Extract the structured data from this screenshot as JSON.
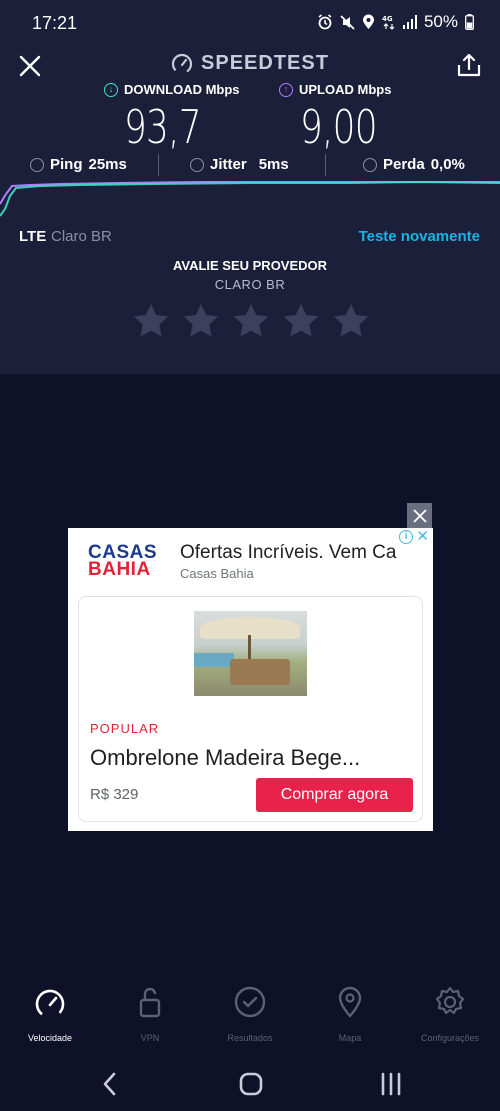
{
  "status_bar": {
    "time": "17:21",
    "battery_text": "50%",
    "icons": [
      "alarm-icon",
      "mute-icon",
      "location-icon",
      "4g-icon",
      "signal-icon",
      "battery-icon"
    ]
  },
  "header": {
    "brand": "SPEEDTEST"
  },
  "results": {
    "download_label": "DOWNLOAD Mbps",
    "upload_label": "UPLOAD Mbps",
    "download_value": "93,7",
    "upload_value": "9,00",
    "ping_label": "Ping",
    "ping_value": "25ms",
    "jitter_label": "Jitter",
    "jitter_value": "5ms",
    "loss_label": "Perda",
    "loss_value": "0,0%"
  },
  "network": {
    "type": "LTE",
    "provider": "Claro BR",
    "retest_label": "Teste novamente"
  },
  "rating": {
    "title": "AVALIE SEU PROVEDOR",
    "provider": "CLARO BR",
    "stars_total": 5,
    "stars_filled": 0
  },
  "ad": {
    "logo_line1": "CASAS",
    "logo_line2": "BAHIA",
    "headline": "Ofertas Incríveis. Vem Ca",
    "advertiser": "Casas Bahia",
    "tag": "POPULAR",
    "product_title": "Ombrelone Madeira Bege...",
    "price": "R$ 329",
    "cta_label": "Comprar agora",
    "info_icon": "i",
    "close_glyph": "✕"
  },
  "bottom_nav": {
    "items": [
      {
        "label": "Velocidade",
        "icon": "speedometer-icon",
        "active": true
      },
      {
        "label": "VPN",
        "icon": "lock-icon",
        "active": false
      },
      {
        "label": "Resultados",
        "icon": "check-circle-icon",
        "active": false
      },
      {
        "label": "Mapa",
        "icon": "map-pin-icon",
        "active": false
      },
      {
        "label": "Configurações",
        "icon": "gear-icon",
        "active": false
      }
    ]
  },
  "colors": {
    "background": "#0f1128",
    "panel": "#1c1f3a",
    "download_accent": "#3fe0c8",
    "upload_accent": "#b07cff",
    "link": "#19b3e6",
    "cta": "#e8224a"
  }
}
